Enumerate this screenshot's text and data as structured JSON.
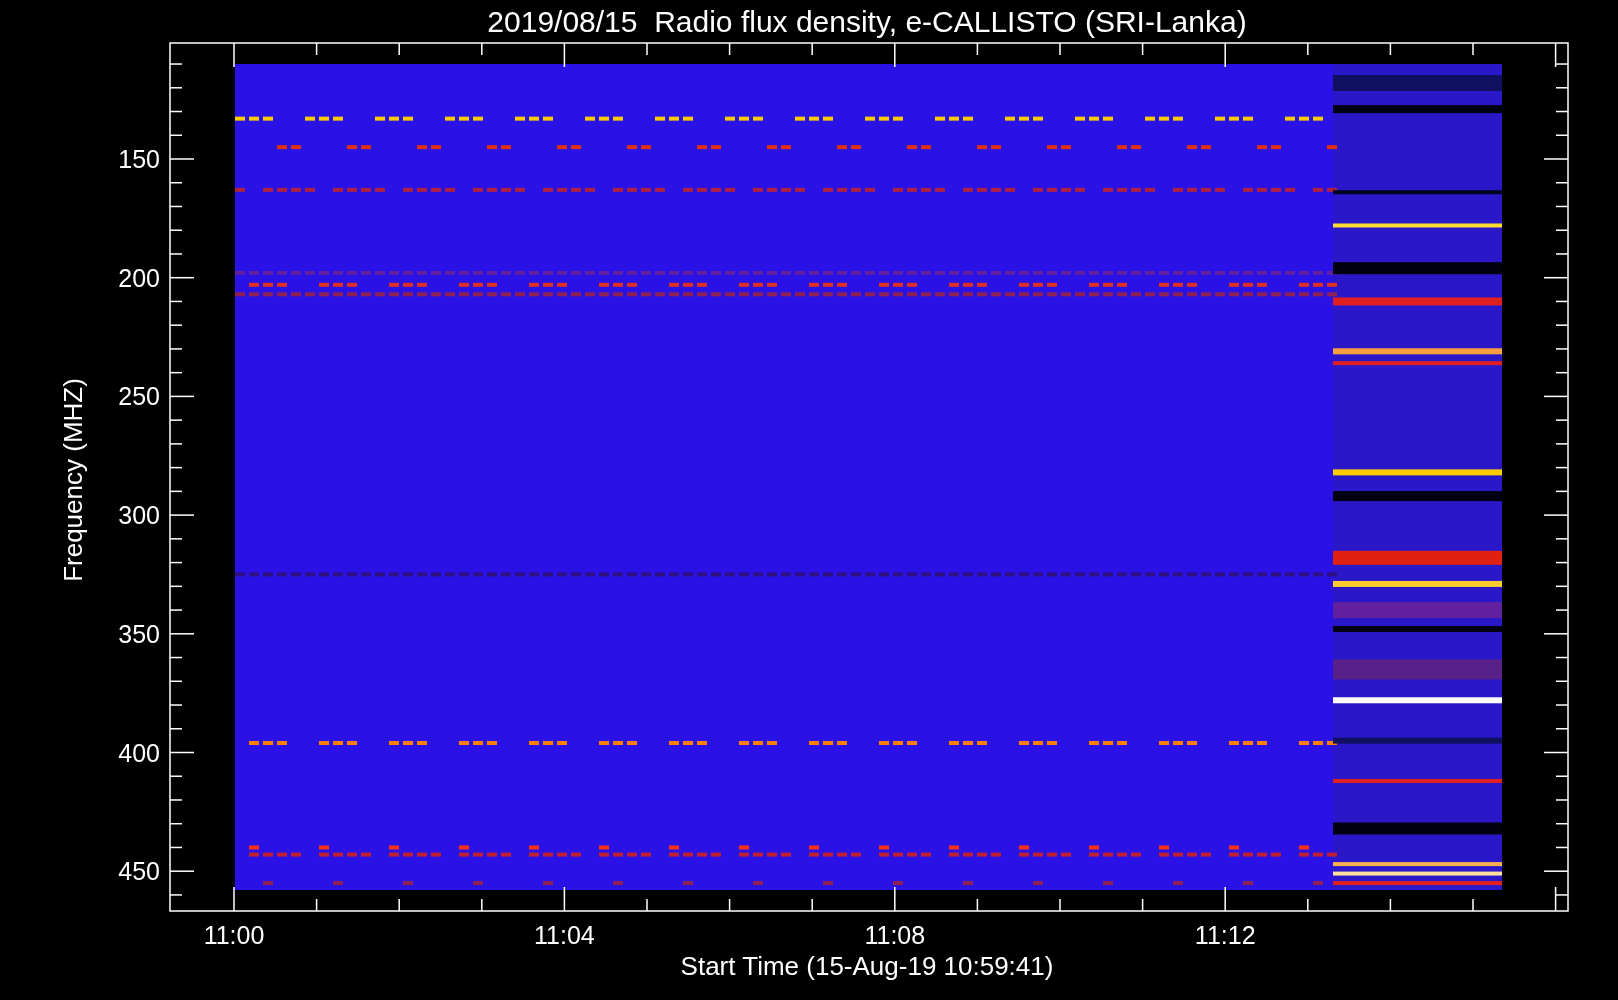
{
  "plot": {
    "title": "2019/08/15  Radio flux density, e-CALLISTO (SRI-Lanka)",
    "ylabel": "Frequency (MHZ)",
    "xlabel": "Start Time (15-Aug-19 10:59:41)",
    "yticks": [
      "150",
      "200",
      "250",
      "300",
      "350",
      "400",
      "450"
    ],
    "xticks": [
      "11:00",
      "11:04",
      "11:08",
      "11:12"
    ]
  }
}
